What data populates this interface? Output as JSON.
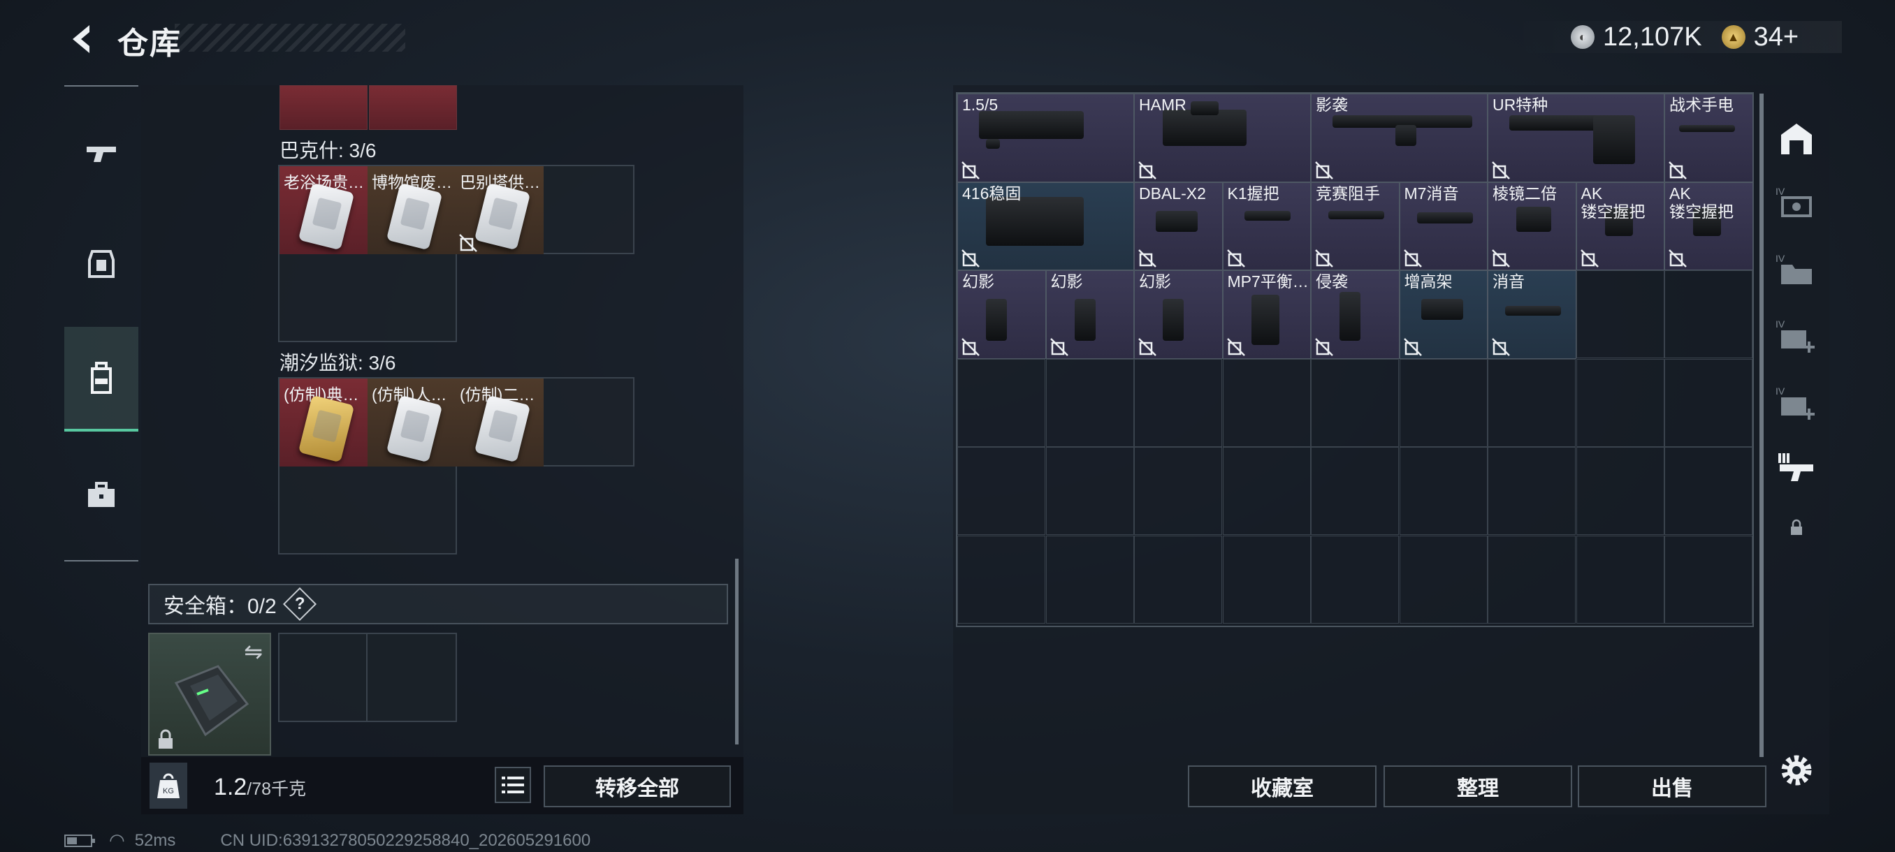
{
  "header": {
    "title": "仓库",
    "currency_silver": "12,107K",
    "currency_gold": "34+"
  },
  "left_nav": {
    "items": [
      "weapon-icon",
      "armor-icon",
      "backpack-icon",
      "toolbox-icon"
    ],
    "active_index": 2
  },
  "left_panel": {
    "groups": [
      {
        "title": "巴克什: 3/6",
        "items": [
          "老浴场贵…",
          "博物馆废…",
          "巴别塔供…"
        ]
      },
      {
        "title": "潮汐监狱: 3/6",
        "items": [
          "(仿制)典…",
          "(仿制)人…",
          "(仿制)二…"
        ]
      }
    ],
    "safe_box_label": "安全箱：0/2",
    "safe_help": "?",
    "weight_current": "1.2",
    "weight_max": "/78千克",
    "transfer_all": "转移全部"
  },
  "right_grid": {
    "items": [
      {
        "label": "1.5/5"
      },
      {
        "label": "HAMR"
      },
      {
        "label": "影袭"
      },
      {
        "label": "UR特种"
      },
      {
        "label": "战术手电"
      },
      {
        "label": "416稳固"
      },
      {
        "label": "DBAL-X2"
      },
      {
        "label": "K1握把"
      },
      {
        "label": "竞赛阻手"
      },
      {
        "label": "M7消音"
      },
      {
        "label": "棱镜二倍"
      },
      {
        "label": "AK\n镂空握把"
      },
      {
        "label": "AK\n镂空握把"
      },
      {
        "label": "幻影"
      },
      {
        "label": "幻影"
      },
      {
        "label": "幻影"
      },
      {
        "label": "MP7平衡…"
      },
      {
        "label": "侵袭"
      },
      {
        "label": "增高架"
      },
      {
        "label": "消音"
      }
    ]
  },
  "bottom_right": {
    "collection": "收藏室",
    "organize": "整理",
    "sell": "出售"
  },
  "status": {
    "ping": "52ms",
    "uid": "CN UID:63913278050229258840_202605291600"
  },
  "colors": {
    "accent": "#58c8a0",
    "purple_rarity": "#3c3a56",
    "blue_rarity": "#2a3e52",
    "red_rarity": "#5a2a2e",
    "orange_rarity": "#4e3a2a"
  }
}
